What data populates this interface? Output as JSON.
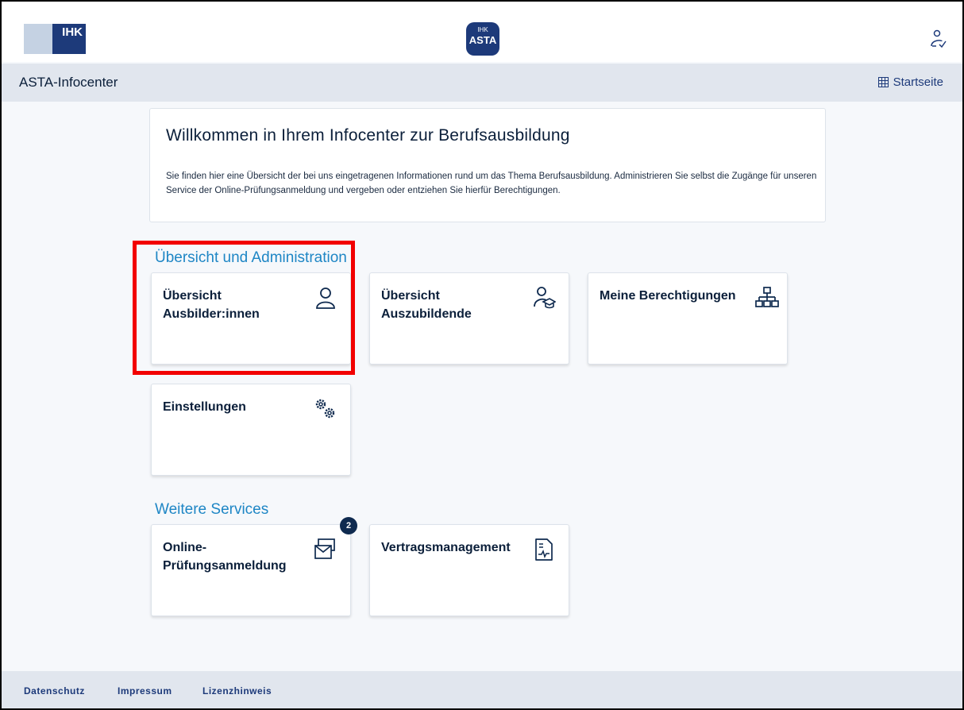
{
  "header": {
    "ihk_logo_text": "IHK",
    "asta_logo_top": "IHK",
    "asta_logo_main": "ASTA"
  },
  "subbar": {
    "title": "ASTA-Infocenter",
    "home_label": "Startseite"
  },
  "welcome": {
    "title": "Willkommen in Ihrem Infocenter zur Berufsausbildung",
    "text": "Sie finden hier eine Übersicht der bei uns eingetragenen Informationen rund um das Thema Berufsausbildung. Administrieren Sie selbst die Zugänge für unseren Service der Online-Prüfungsanmeldung und vergeben oder entziehen Sie hierfür Berechtigungen."
  },
  "sections": [
    {
      "title": "Übersicht und Administration",
      "cards": [
        {
          "label": "Übersicht Ausbilder:innen",
          "icon": "person-icon"
        },
        {
          "label": "Übersicht Auszubildende",
          "icon": "graduate-icon"
        },
        {
          "label": "Meine Berechtigungen",
          "icon": "org-chart-icon"
        },
        {
          "label": "Einstellungen",
          "icon": "gears-icon"
        }
      ]
    },
    {
      "title": "Weitere Services",
      "cards": [
        {
          "label": "Online-Prüfungsanmeldung",
          "icon": "mail-stack-icon",
          "badge": "2"
        },
        {
          "label": "Vertragsmanagement",
          "icon": "document-chart-icon"
        }
      ]
    }
  ],
  "footer": {
    "links": [
      "Datenschutz",
      "Impressum",
      "Lizenzhinweis"
    ]
  },
  "colors": {
    "brand_dark": "#1d3a7a",
    "section_blue": "#1e86c5",
    "highlight_red": "#f20000"
  }
}
